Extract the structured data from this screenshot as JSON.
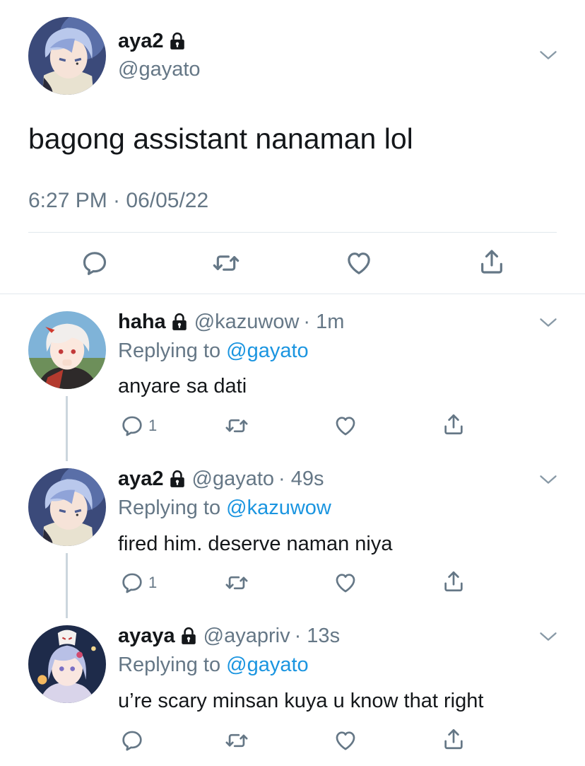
{
  "main_tweet": {
    "name": "aya2",
    "handle": "@gayato",
    "text": "bagong assistant nanaman lol",
    "timestamp": "6:27 PM · 06/05/22"
  },
  "replies": [
    {
      "name": "haha",
      "handle": "@kazuwow",
      "time": "· 1m",
      "replying_prefix": "Replying to",
      "replying_to": "@gayato",
      "text": "anyare sa dati",
      "reply_count": "1"
    },
    {
      "name": "aya2",
      "handle": "@gayato",
      "time": "· 49s",
      "replying_prefix": "Replying to",
      "replying_to": "@kazuwow",
      "text": "fired him. deserve naman niya",
      "reply_count": "1"
    },
    {
      "name": "ayaya",
      "handle": "@ayapriv",
      "time": "· 13s",
      "replying_prefix": "Replying to",
      "replying_to": "@gayato",
      "text": "u’re scary minsan kuya u know that right",
      "reply_count": ""
    }
  ],
  "colors": {
    "text": "#14171a",
    "secondary": "#657786",
    "link": "#1b95e0",
    "divider": "#e1e8ed"
  },
  "icons": [
    "lock-icon",
    "chevron-down-icon",
    "reply-icon",
    "retweet-icon",
    "like-icon",
    "share-icon"
  ]
}
